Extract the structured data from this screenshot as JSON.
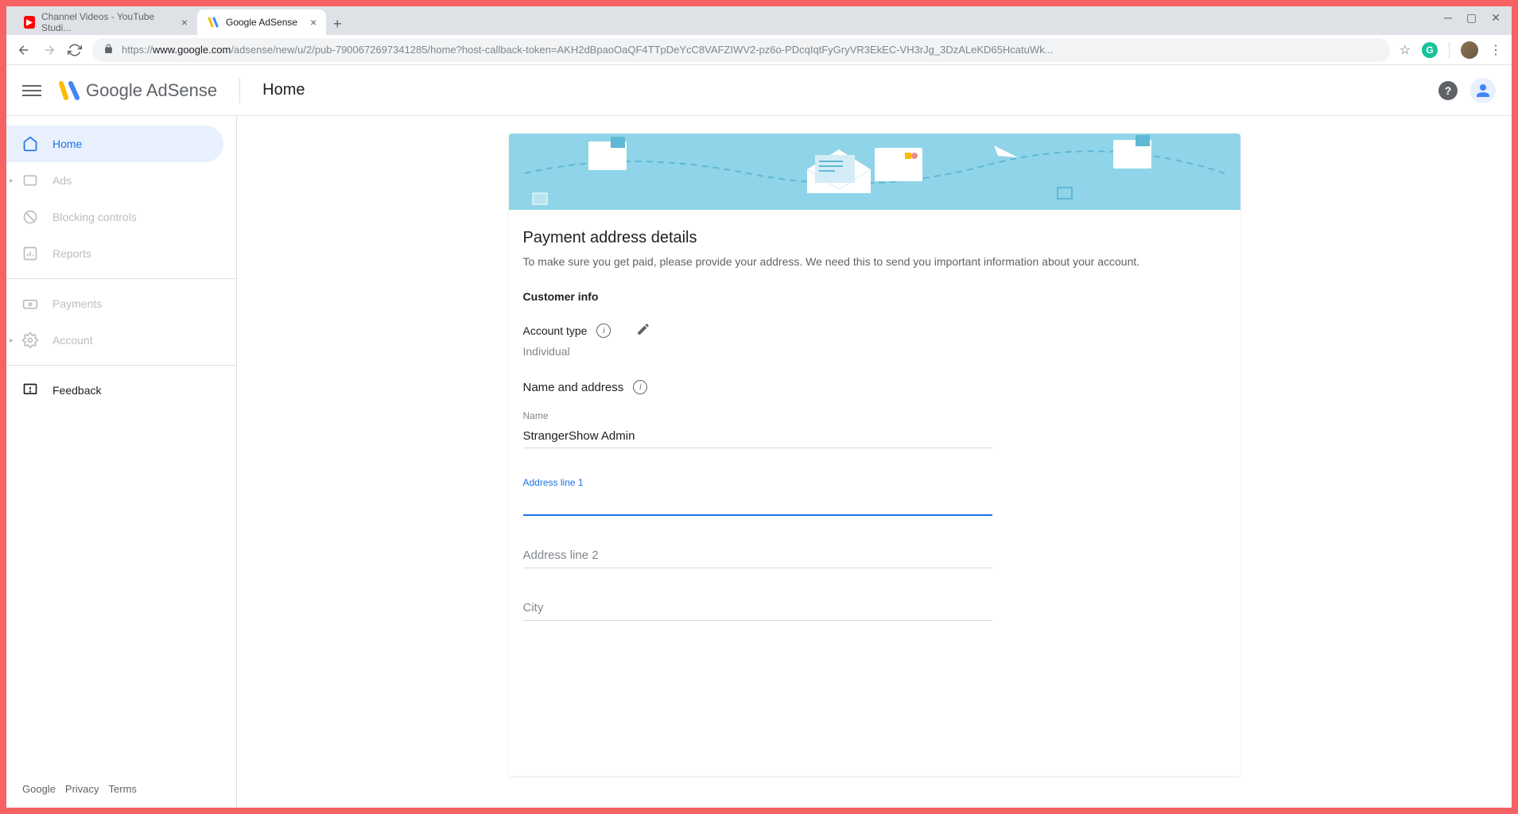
{
  "browser": {
    "tabs": [
      {
        "title": "Channel Videos - YouTube Studi...",
        "favicon": "youtube"
      },
      {
        "title": "Google AdSense",
        "favicon": "adsense",
        "active": true
      }
    ],
    "url_prefix": "https://",
    "url_domain": "www.google.com",
    "url_path": "/adsense/new/u/2/pub-7900672697341285/home?host-callback-token=AKH2dBpaoOaQF4TTpDeYcC8VAFZIWV2-pz6o-PDcqIqtFyGryVR3EkEC-VH3rJg_3DzALeKD65HcatuWk..."
  },
  "header": {
    "brand": "Google AdSense",
    "page_title": "Home"
  },
  "sidebar": {
    "items": [
      {
        "label": "Home",
        "active": true
      },
      {
        "label": "Ads"
      },
      {
        "label": "Blocking controls"
      },
      {
        "label": "Reports"
      },
      {
        "label": "Payments"
      },
      {
        "label": "Account"
      },
      {
        "label": "Feedback",
        "feedback": true
      }
    ],
    "footer": {
      "brand": "Google",
      "privacy": "Privacy",
      "terms": "Terms"
    }
  },
  "card": {
    "title": "Payment address details",
    "description": "To make sure you get paid, please provide your address. We need this to send you important information about your account.",
    "customer_info": "Customer info",
    "account_type_label": "Account type",
    "account_type_value": "Individual",
    "name_address_label": "Name and address",
    "fields": {
      "name_label": "Name",
      "name_value": "StrangerShow Admin",
      "addr1_label": "Address line 1",
      "addr1_value": "",
      "addr2_placeholder": "Address line 2",
      "city_placeholder": "City"
    }
  }
}
